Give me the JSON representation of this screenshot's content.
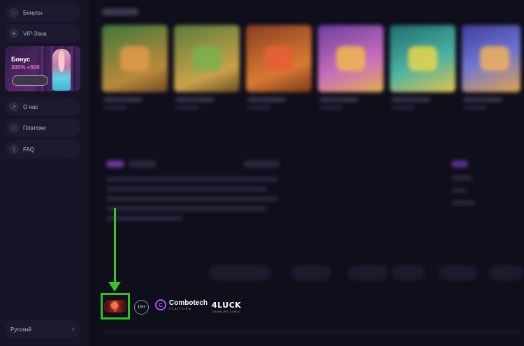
{
  "sidebar": {
    "items_top": [
      {
        "label": "Бонусы",
        "icon": "gift-icon"
      },
      {
        "label": "VIP-Зона",
        "icon": "sparkle-icon"
      }
    ],
    "promo": {
      "title": "Бонус",
      "subtitle": "300% +500"
    },
    "items_bottom": [
      {
        "label": "О нас",
        "icon": "rocket-icon"
      },
      {
        "label": "Платежи",
        "icon": "wallet-icon"
      },
      {
        "label": "FAQ",
        "icon": "info-icon"
      }
    ],
    "language": {
      "label": "Русский"
    }
  },
  "footer": {
    "age_label": "18+",
    "combotech": {
      "name": "Combotech",
      "sub": "PLATFORM"
    },
    "fourluck": {
      "name": "4LUCK",
      "sub": "GAMBLING GAMES"
    }
  },
  "colors": {
    "page_bg": "#0f0e1b",
    "sidebar_bg": "#161426",
    "accent_purple": "#a955ff",
    "annotation_green": "#3cc327"
  }
}
